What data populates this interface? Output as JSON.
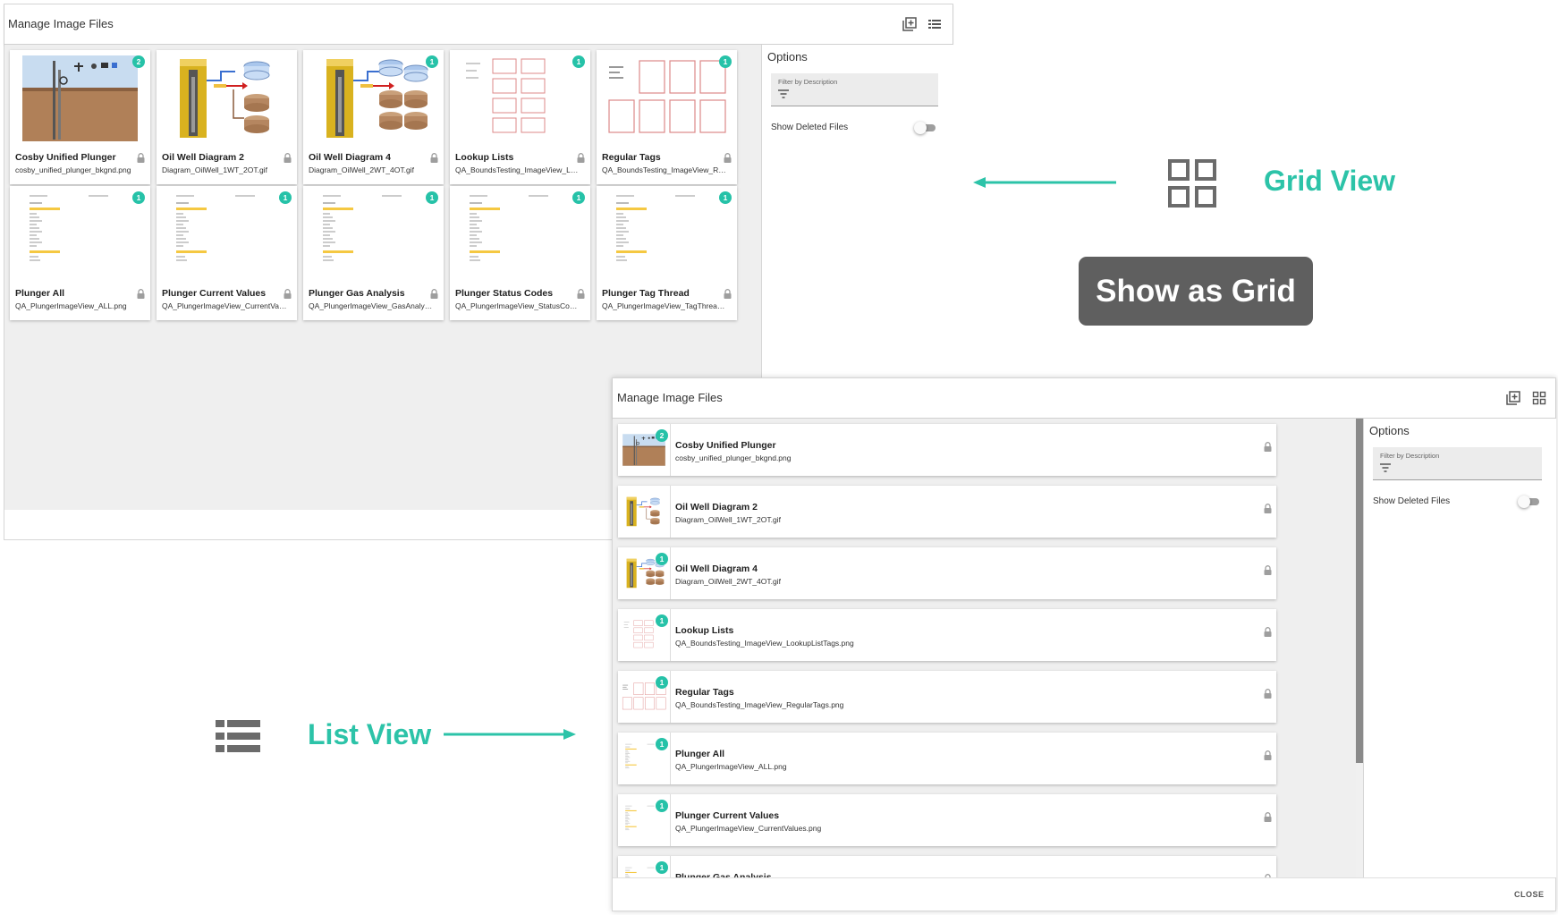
{
  "grid_panel": {
    "title": "Manage Image Files",
    "add_icon": "add-image-icon",
    "list_icon": "list-view-icon",
    "cards": [
      {
        "title": "Cosby Unified Plunger",
        "file": "cosby_unified_plunger_bkgnd.png",
        "badge": "2",
        "thumb": "plunger-scene"
      },
      {
        "title": "Oil Well Diagram 2",
        "file": "Diagram_OilWell_1WT_2OT.gif",
        "badge": "",
        "thumb": "oilwell-2"
      },
      {
        "title": "Oil Well Diagram 4",
        "file": "Diagram_OilWell_2WT_4OT.gif",
        "badge": "1",
        "thumb": "oilwell-4"
      },
      {
        "title": "Lookup Lists",
        "file": "QA_BoundsTesting_ImageView_LookupListTags.png",
        "badge": "1",
        "thumb": "lookup"
      },
      {
        "title": "Regular Tags",
        "file": "QA_BoundsTesting_ImageView_RegularTags.png",
        "badge": "1",
        "thumb": "regular"
      },
      {
        "title": "Plunger All",
        "file": "QA_PlungerImageView_ALL.png",
        "badge": "1",
        "thumb": "doc"
      },
      {
        "title": "Plunger Current Values",
        "file": "QA_PlungerImageView_CurrentValues.png",
        "badge": "1",
        "thumb": "doc"
      },
      {
        "title": "Plunger Gas Analysis",
        "file": "QA_PlungerImageView_GasAnalysis.png",
        "badge": "1",
        "thumb": "doc"
      },
      {
        "title": "Plunger Status Codes",
        "file": "QA_PlungerImageView_StatusCodes.png",
        "badge": "1",
        "thumb": "doc"
      },
      {
        "title": "Plunger Tag Thread",
        "file": "QA_PlungerImageView_TagThread.png",
        "badge": "1",
        "thumb": "doc"
      }
    ],
    "options": {
      "title": "Options",
      "filter_label": "Filter by Description",
      "show_deleted": "Show Deleted Files"
    }
  },
  "list_panel": {
    "title": "Manage Image Files",
    "add_icon": "add-image-icon",
    "grid_icon": "grid-view-icon",
    "rows": [
      {
        "title": "Cosby Unified Plunger",
        "file": "cosby_unified_plunger_bkgnd.png",
        "badge": "2",
        "thumb": "plunger-scene"
      },
      {
        "title": "Oil Well Diagram 2",
        "file": "Diagram_OilWell_1WT_2OT.gif",
        "badge": "",
        "thumb": "oilwell-2"
      },
      {
        "title": "Oil Well Diagram 4",
        "file": "Diagram_OilWell_2WT_4OT.gif",
        "badge": "1",
        "thumb": "oilwell-4"
      },
      {
        "title": "Lookup Lists",
        "file": "QA_BoundsTesting_ImageView_LookupListTags.png",
        "badge": "1",
        "thumb": "lookup"
      },
      {
        "title": "Regular Tags",
        "file": "QA_BoundsTesting_ImageView_RegularTags.png",
        "badge": "1",
        "thumb": "regular"
      },
      {
        "title": "Plunger All",
        "file": "QA_PlungerImageView_ALL.png",
        "badge": "1",
        "thumb": "doc"
      },
      {
        "title": "Plunger Current Values",
        "file": "QA_PlungerImageView_CurrentValues.png",
        "badge": "1",
        "thumb": "doc"
      },
      {
        "title": "Plunger Gas Analysis",
        "file": "",
        "badge": "1",
        "thumb": "doc"
      }
    ],
    "options": {
      "title": "Options",
      "filter_label": "Filter by Description",
      "show_deleted": "Show Deleted Files"
    },
    "close_label": "CLOSE"
  },
  "annotations": {
    "grid_view_label": "Grid View",
    "tooltip": "Show as Grid",
    "list_view_label": "List View"
  },
  "colors": {
    "accent": "#2cc3a8",
    "badge": "#26c2a8",
    "tooltip_bg": "#5f5f5f"
  }
}
